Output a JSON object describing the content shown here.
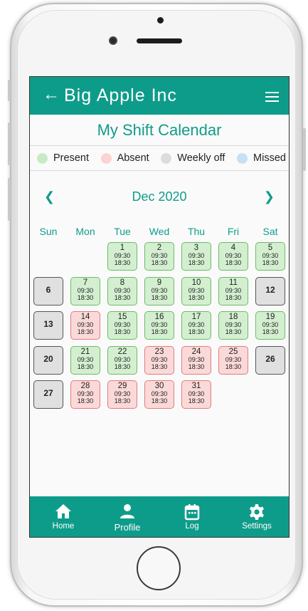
{
  "app": {
    "title": "Big Apple Inc",
    "back_icon": "arrow-left-icon",
    "menu_icon": "hamburger-menu-icon"
  },
  "page": {
    "title": "My Shift Calendar"
  },
  "legend": [
    {
      "label": "Present",
      "color": "#c8ebc5"
    },
    {
      "label": "Absent",
      "color": "#fbd3d3"
    },
    {
      "label": "Weekly off",
      "color": "#dcdcdc"
    },
    {
      "label": "Missed",
      "color": "#c6e0f5"
    }
  ],
  "calendar": {
    "month_label": "Dec 2020",
    "prev_icon": "chevron-left-icon",
    "next_icon": "chevron-right-icon",
    "weekdays": [
      "Sun",
      "Mon",
      "Tue",
      "Wed",
      "Thu",
      "Fri",
      "Sat"
    ],
    "days": [
      {
        "day": "1",
        "status": "present",
        "in": "09:30",
        "out": "18:30"
      },
      {
        "day": "2",
        "status": "present",
        "in": "09:30",
        "out": "18:30"
      },
      {
        "day": "3",
        "status": "present",
        "in": "09:30",
        "out": "18:30"
      },
      {
        "day": "4",
        "status": "present",
        "in": "09:30",
        "out": "18:30"
      },
      {
        "day": "5",
        "status": "present",
        "in": "09:30",
        "out": "18:30"
      },
      {
        "day": "6",
        "status": "weekly-off"
      },
      {
        "day": "7",
        "status": "present",
        "in": "09:30",
        "out": "18:30"
      },
      {
        "day": "8",
        "status": "present",
        "in": "09:30",
        "out": "18:30"
      },
      {
        "day": "9",
        "status": "present",
        "in": "09:30",
        "out": "18:30"
      },
      {
        "day": "10",
        "status": "present",
        "in": "09:30",
        "out": "18:30"
      },
      {
        "day": "11",
        "status": "present",
        "in": "09:30",
        "out": "18:30"
      },
      {
        "day": "12",
        "status": "weekly-off"
      },
      {
        "day": "13",
        "status": "weekly-off"
      },
      {
        "day": "14",
        "status": "absent",
        "in": "09:30",
        "out": "18:30"
      },
      {
        "day": "15",
        "status": "present",
        "in": "09:30",
        "out": "18:30"
      },
      {
        "day": "16",
        "status": "present",
        "in": "09:30",
        "out": "18:30"
      },
      {
        "day": "17",
        "status": "present",
        "in": "09:30",
        "out": "18:30"
      },
      {
        "day": "18",
        "status": "present",
        "in": "09:30",
        "out": "18:30"
      },
      {
        "day": "19",
        "status": "present",
        "in": "09:30",
        "out": "18:30"
      },
      {
        "day": "20",
        "status": "weekly-off"
      },
      {
        "day": "21",
        "status": "present",
        "in": "09:30",
        "out": "18:30"
      },
      {
        "day": "22",
        "status": "present",
        "in": "09:30",
        "out": "18:30"
      },
      {
        "day": "23",
        "status": "absent",
        "in": "09:30",
        "out": "18:30"
      },
      {
        "day": "24",
        "status": "absent",
        "in": "09:30",
        "out": "18:30"
      },
      {
        "day": "25",
        "status": "absent",
        "in": "09:30",
        "out": "18:30"
      },
      {
        "day": "26",
        "status": "weekly-off"
      },
      {
        "day": "27",
        "status": "weekly-off"
      },
      {
        "day": "28",
        "status": "absent",
        "in": "09:30",
        "out": "18:30"
      },
      {
        "day": "29",
        "status": "absent",
        "in": "09:30",
        "out": "18:30"
      },
      {
        "day": "30",
        "status": "absent",
        "in": "09:30",
        "out": "18:30"
      },
      {
        "day": "31",
        "status": "absent",
        "in": "09:30",
        "out": "18:30"
      }
    ]
  },
  "bottom_nav": [
    {
      "label": "Home",
      "icon": "home-icon"
    },
    {
      "label": "Profile",
      "icon": "person-icon"
    },
    {
      "label": "Log",
      "icon": "calendar-icon"
    },
    {
      "label": "Settings",
      "icon": "gear-icon"
    }
  ],
  "colors": {
    "brand": "#0e9c8a",
    "present_border": "#6dbb67",
    "absent_border": "#e07d7d"
  }
}
